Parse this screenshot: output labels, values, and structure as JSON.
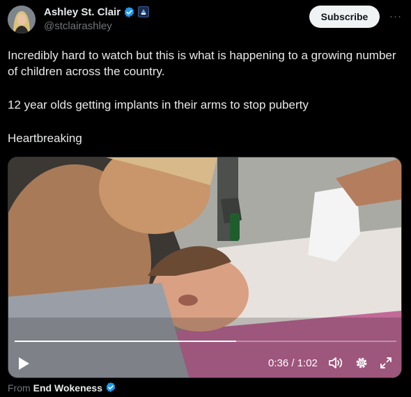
{
  "post": {
    "author_name": "Ashley St. Clair",
    "handle": "@stclairashley",
    "subscribe_label": "Subscribe",
    "more_label": "···",
    "paragraphs": [
      "Incredibly hard to watch but this is what is happening to a growing number of children across the country.",
      "12 year olds getting implants in their arms to stop puberty",
      "Heartbreaking"
    ]
  },
  "video": {
    "time_display": "0:36 / 1:02",
    "progress": 0.58
  },
  "attribution": {
    "prefix": "From",
    "source_name": "End Wokeness"
  },
  "colors": {
    "background": "#000000",
    "verified_blue": "#1d9bf0",
    "affiliate_blue": "#3a5a9c",
    "subscribe_bg": "#eff3f4",
    "secondary_text": "#71767b"
  },
  "icons": [
    "verified-badge-icon",
    "affiliate-badge-icon",
    "more-options-icon",
    "play-icon",
    "volume-icon",
    "settings-gear-icon",
    "fullscreen-icon"
  ]
}
